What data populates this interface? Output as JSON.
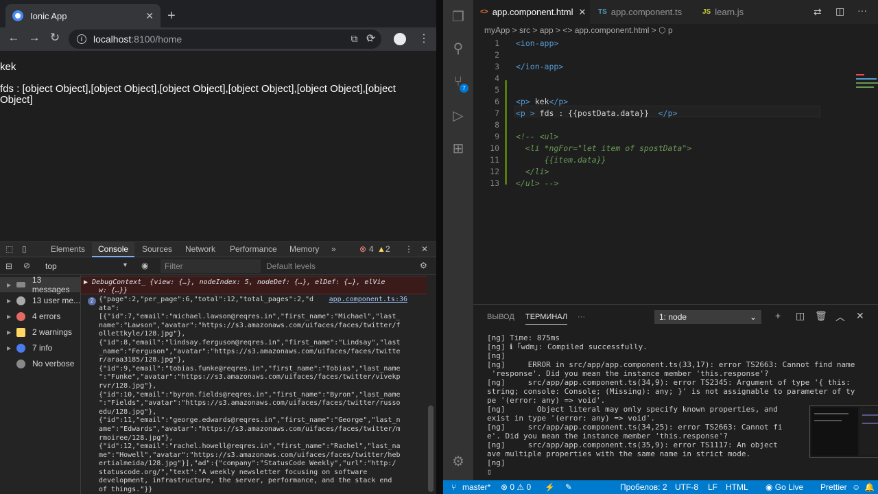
{
  "browser": {
    "tab_title": "Ionic App",
    "url_host": "localhost",
    "url_path": ":8100/home"
  },
  "page": {
    "line1": "kek",
    "line2": "fds : [object Object],[object Object],[object Object],[object Object],[object Object],[object",
    "line3": "Object]"
  },
  "devtools": {
    "tabs": [
      "Elements",
      "Console",
      "Sources",
      "Network",
      "Performance",
      "Memory"
    ],
    "more": "»",
    "error_count": "4",
    "warning_count": "2",
    "context": "top",
    "filter_placeholder": "Filter",
    "levels": "Default levels",
    "sidebar": [
      {
        "label": "13 messages"
      },
      {
        "label": "13 user me..."
      },
      {
        "label": "4 errors"
      },
      {
        "label": "2 warnings"
      },
      {
        "label": "7 info"
      },
      {
        "label": "No verbose"
      }
    ],
    "error_line1": "▶ DebugContext_ {view: {…}, nodeIndex: 5, nodeDef: {…}, elDef: {…}, elVie",
    "error_line2": "w: {…}}",
    "log_badge": "2",
    "log_source": "app.component.ts:36",
    "log_lines": [
      "{\"page\":2,\"per_page\":6,\"total\":12,\"total_pages\":2,\"d",
      "ata\":",
      "[{\"id\":7,\"email\":\"michael.lawson@reqres.in\",\"first_name\":\"Michael\",\"last_",
      "name\":\"Lawson\",\"avatar\":\"https://s3.amazonaws.com/uifaces/faces/twitter/f",
      "ollettkyle/128.jpg\"},",
      "{\"id\":8,\"email\":\"lindsay.ferguson@reqres.in\",\"first_name\":\"Lindsay\",\"last",
      "_name\":\"Ferguson\",\"avatar\":\"https://s3.amazonaws.com/uifaces/faces/twitte",
      "r/araa3185/128.jpg\"},",
      "{\"id\":9,\"email\":\"tobias.funke@reqres.in\",\"first_name\":\"Tobias\",\"last_name",
      "\":\"Funke\",\"avatar\":\"https://s3.amazonaws.com/uifaces/faces/twitter/vivekp",
      "rvr/128.jpg\"},",
      "{\"id\":10,\"email\":\"byron.fields@reqres.in\",\"first_name\":\"Byron\",\"last_name",
      "\":\"Fields\",\"avatar\":\"https://s3.amazonaws.com/uifaces/faces/twitter/russo",
      "edu/128.jpg\"},",
      "{\"id\":11,\"email\":\"george.edwards@reqres.in\",\"first_name\":\"George\",\"last_n",
      "ame\":\"Edwards\",\"avatar\":\"https://s3.amazonaws.com/uifaces/faces/twitter/m",
      "rmoiree/128.jpg\"},",
      "{\"id\":12,\"email\":\"rachel.howell@reqres.in\",\"first_name\":\"Rachel\",\"last_na",
      "me\":\"Howell\",\"avatar\":\"https://s3.amazonaws.com/uifaces/faces/twitter/heb",
      "ertialmeida/128.jpg\"}],\"ad\":{\"company\":\"StatusCode Weekly\",\"url\":\"http:/",
      "statuscode.org/\",\"text\":\"A weekly newsletter focusing on software",
      "development, infrastructure, the server, performance, and the stack end",
      "of things.\"}}"
    ]
  },
  "vscode": {
    "tabs": [
      {
        "ext": "<>",
        "label": "app.component.html"
      },
      {
        "ext": "TS",
        "label": "app.component.ts"
      },
      {
        "ext": "JS",
        "label": "learn.js"
      }
    ],
    "breadcrumb": "myApp  >  src  >  app  >  <>  app.component.html  >  ⬡  p",
    "code": [
      {
        "n": "1",
        "t": "<ion-app>"
      },
      {
        "n": "2",
        "t": ""
      },
      {
        "n": "3",
        "t": "</ion-app>"
      },
      {
        "n": "4",
        "t": ""
      },
      {
        "n": "5",
        "t": ""
      },
      {
        "n": "6",
        "t": "<p> kek</p>"
      },
      {
        "n": "7",
        "t": "<p > fds : {{postData.data}}  </p>"
      },
      {
        "n": "8",
        "t": ""
      },
      {
        "n": "9",
        "t": "<!-- <ul>"
      },
      {
        "n": "10",
        "t": "  <li *ngFor=\"let item of spostData\">"
      },
      {
        "n": "11",
        "t": "      {{item.data}}"
      },
      {
        "n": "12",
        "t": "  </li>"
      },
      {
        "n": "13",
        "t": "</ul> -->"
      }
    ],
    "panel_tabs": [
      "ВЫВОД",
      "ТЕРМИНАЛ",
      "···"
    ],
    "terminal_select": "1: node",
    "terminal": [
      "[ng] Time: 875ms",
      "[ng] ℹ ｢wdm｣: Compiled successfully.",
      "[ng]",
      "[ng]     ERROR in src/app/app.component.ts(33,17): error TS2663: Cannot find name",
      " 'response'. Did you mean the instance member 'this.response'?",
      "[ng]     src/app/app.component.ts(34,9): error TS2345: Argument of type '{ this:",
      "string; console: Console; (Missing): any; }' is not assignable to parameter of ty",
      "pe '(error: any) => void'.",
      "[ng]       Object literal may only specify known properties, and",
      "exist in type '(error: any) => void'.",
      "[ng]     src/app/app.component.ts(34,25): error TS2663: Cannot fi",
      "e'. Did you mean the instance member 'this.response'?",
      "[ng]     src/app/app.component.ts(35,9): error TS1117: An object",
      "ave multiple properties with the same name in strict mode.",
      "[ng]",
      "▯"
    ],
    "status": {
      "branch": "master*",
      "errors": "⊗ 0 ⚠ 0",
      "spaces": "Пробелов: 2",
      "encoding": "UTF-8",
      "eol": "LF",
      "lang": "HTML",
      "golive": "◉ Go Live",
      "prettier": "Prettier"
    }
  }
}
